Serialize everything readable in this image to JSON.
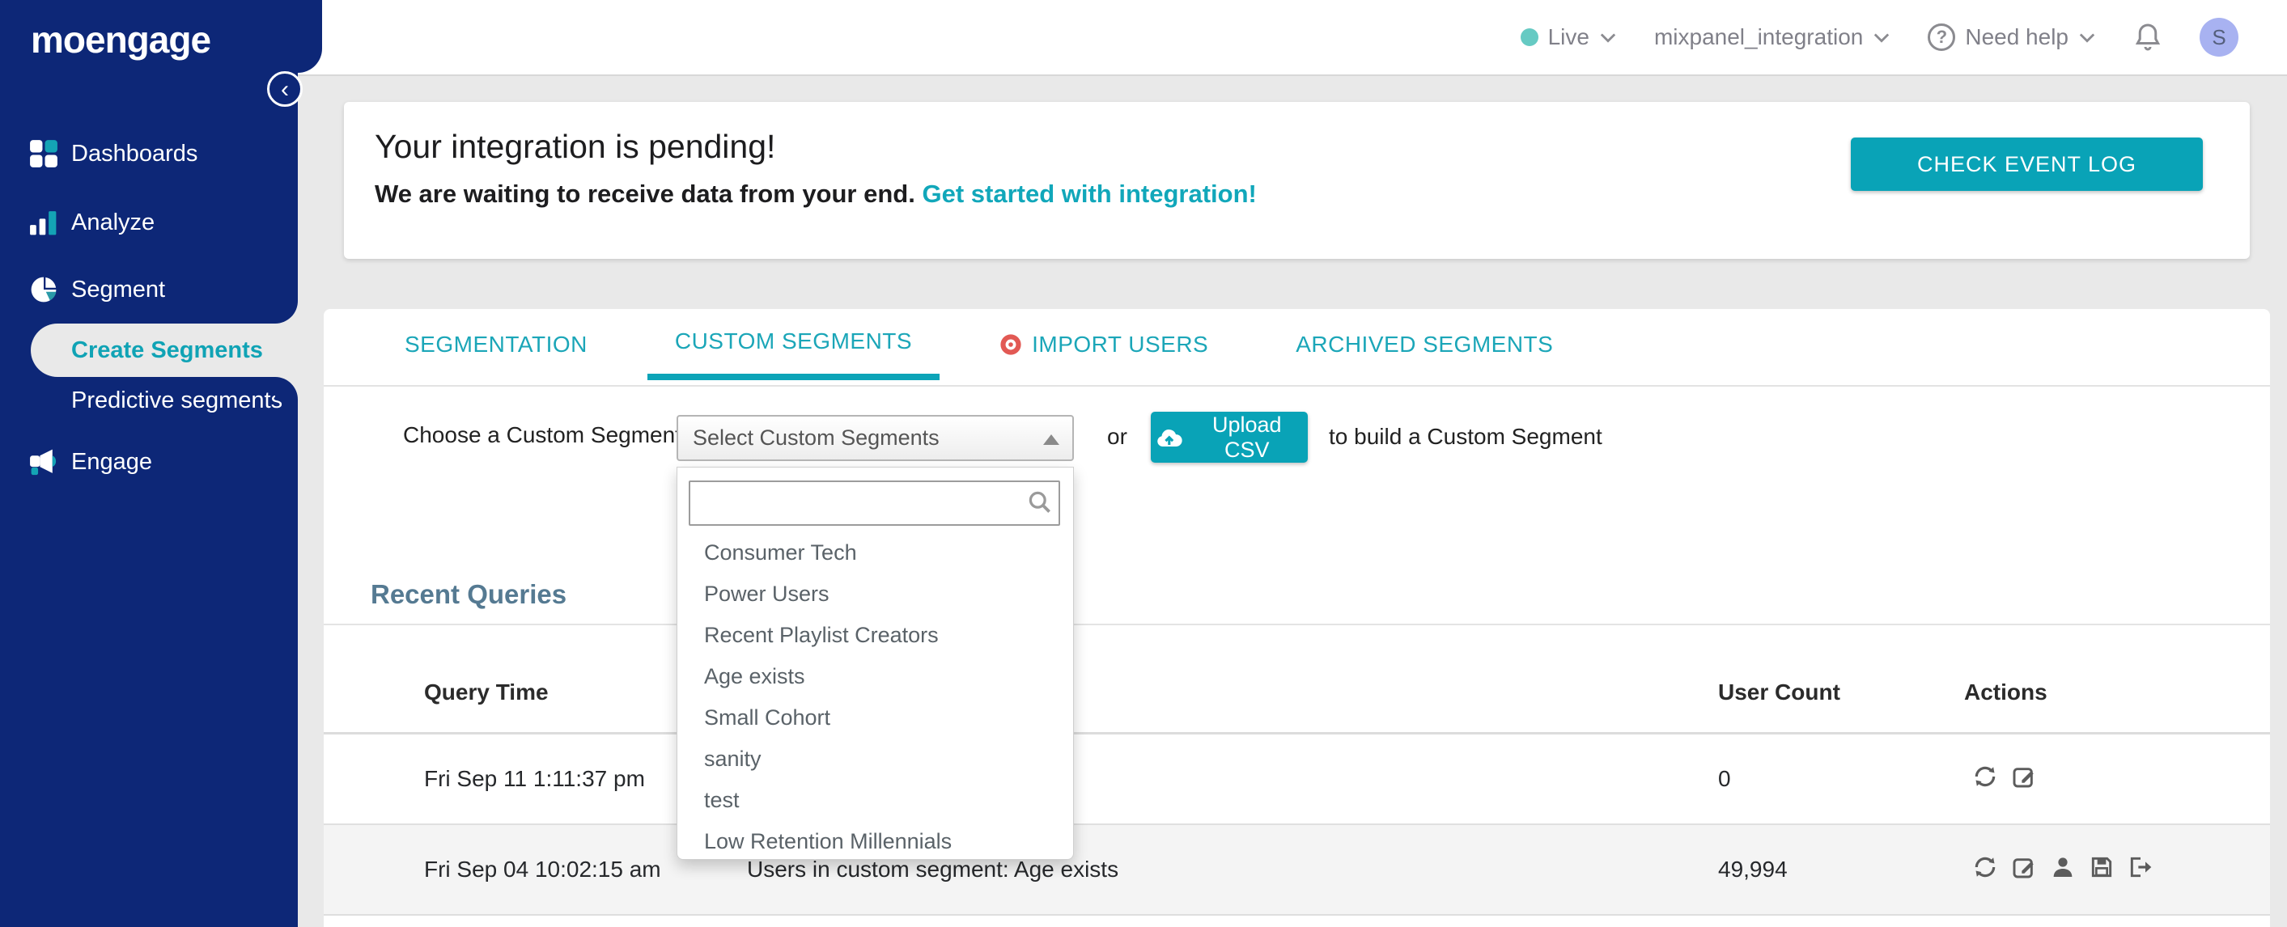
{
  "sidebar": {
    "logo": "moengage",
    "items": [
      {
        "label": "Dashboards",
        "icon": "dashboards-icon"
      },
      {
        "label": "Analyze",
        "icon": "analyze-icon"
      },
      {
        "label": "Segment",
        "icon": "segment-icon"
      },
      {
        "label": "Create Segments",
        "active": true
      },
      {
        "label": "Predictive segments"
      },
      {
        "label": "Engage",
        "icon": "engage-icon"
      }
    ],
    "collapse_glyph": "‹"
  },
  "topbar": {
    "environment": "Live",
    "workspace": "mixpanel_integration",
    "help": "Need help",
    "help_glyph": "?",
    "avatar_initial": "S"
  },
  "banner": {
    "title": "Your integration is pending!",
    "subtitle": "We are waiting to receive data from your end.",
    "link": "Get started with integration!",
    "button": "CHECK EVENT LOG"
  },
  "tabs": {
    "items": [
      {
        "label": "SEGMENTATION"
      },
      {
        "label": "CUSTOM SEGMENTS"
      },
      {
        "label": "IMPORT USERS"
      },
      {
        "label": "ARCHIVED SEGMENTS"
      }
    ],
    "active": "CUSTOM SEGMENTS"
  },
  "picker": {
    "label": "Choose a Custom Segment:",
    "select_value": "Select Custom Segments",
    "or": "or",
    "upload_button": "Upload CSV",
    "suffix": "to build a Custom Segment"
  },
  "dropdown": {
    "search_placeholder": "",
    "options": [
      "Consumer Tech",
      "Power Users",
      "Recent Playlist Creators",
      "Age exists",
      "Small Cohort",
      "sanity",
      "test",
      "Low Retention Millennials"
    ]
  },
  "recent_queries": {
    "heading": "Recent Queries",
    "columns": {
      "time": "Query Time",
      "user_count": "User Count",
      "actions": "Actions"
    },
    "rows": [
      {
        "time": "Fri Sep 11 1:11:37 pm",
        "query": "",
        "user_count": "0"
      },
      {
        "time": "Fri Sep 04 10:02:15 am",
        "query": "Users in custom segment: Age exists",
        "user_count": "49,994"
      }
    ]
  },
  "colors": {
    "sidebar_navy": "#0d2777",
    "accent_teal": "#0ca4b8",
    "live_dot": "#66cac3",
    "import_dot": "#e25954",
    "heading_slate": "#557a92",
    "avatar_bg": "#a8b2f1",
    "page_bg": "#e9e9e9"
  }
}
